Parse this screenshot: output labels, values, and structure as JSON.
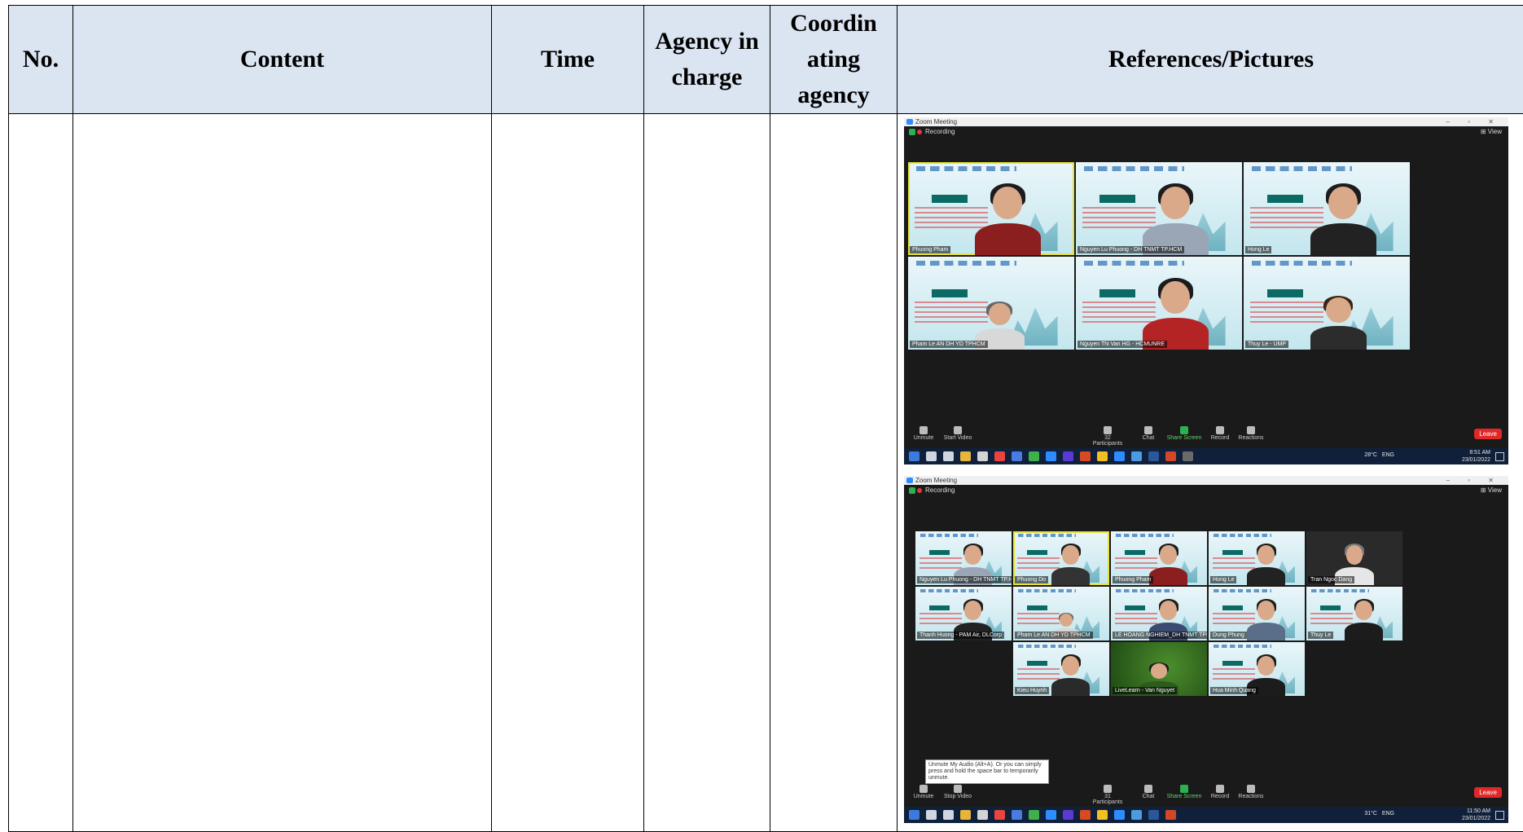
{
  "table": {
    "headers": {
      "no": "No.",
      "content": "Content",
      "time": "Time",
      "agency": "Agency in charge",
      "coordinating": "Coordin ating agency",
      "references": "References/Pictures"
    }
  },
  "zoom": {
    "window_title": "Zoom Meeting",
    "recording": "Recording",
    "view": "View",
    "controls": {
      "unmute": "Unmute",
      "start_video": "Start Video",
      "stop_video": "Stop Video",
      "participants": "Participants",
      "chat": "Chat",
      "share_screen": "Share Screen",
      "record": "Record",
      "reactions": "Reactions",
      "leave": "Leave"
    },
    "shot1": {
      "participant_count": "32",
      "names": [
        "Phuong Pham",
        "Nguyen Lu Phuong - DH TNMT TP.HCM",
        "Hong Le",
        "Pham Le AN DH YD TPHCM",
        "Nguyen Thi Van HG - HCMUNRE",
        "Thuy Le - UMP"
      ],
      "weather": "28°C",
      "lang": "ENG",
      "time": "8:51 AM",
      "date": "23/01/2022"
    },
    "shot2": {
      "participant_count": "31",
      "names": [
        "Nguyen Lu Phuong - DH TNMT TP.HCM",
        "Phuong Do",
        "Phuong Pham",
        "Hong Le",
        "Tran Ngoc Dang",
        "Thanh Huong - PAM Air, DLCorp",
        "Pham Le AN DH YD TPHCM",
        "LE HOANG NGHIEM_DH TNMT TPHC",
        "Dung Phung",
        "Thuy Le",
        "Kieu Huynh",
        "LiveLearn - Van Nguyet",
        "Hua Minh Quang"
      ],
      "tooltip": "Unmute My Audio (Alt+A). Or you can simply press and hold the space bar to temporarily unmute.",
      "weather": "31°C",
      "lang": "ENG",
      "time": "11:50 AM",
      "date": "23/01/2022"
    }
  }
}
